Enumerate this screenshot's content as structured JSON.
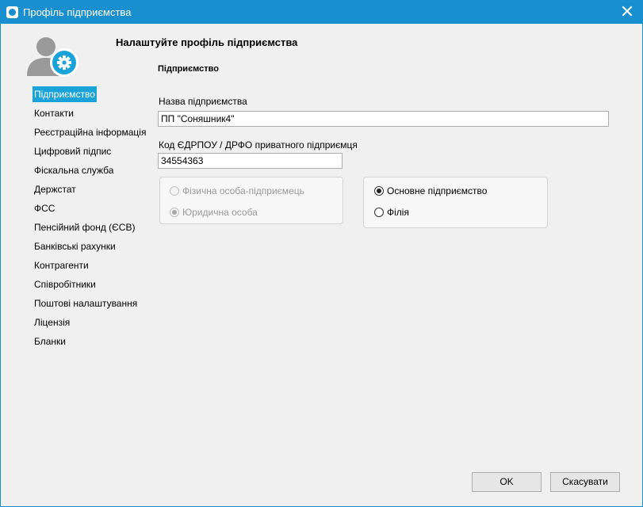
{
  "window": {
    "title": "Профіль підприємства"
  },
  "heading": "Налаштуйте профіль підприємства",
  "nav": {
    "items": [
      {
        "label": "Підприємство",
        "active": true
      },
      {
        "label": "Контакти"
      },
      {
        "label": "Реєстраційна інформація"
      },
      {
        "label": "Цифровий підпис"
      },
      {
        "label": "Фіскальна служба"
      },
      {
        "label": "Держстат"
      },
      {
        "label": "ФСС"
      },
      {
        "label": "Пенсійний фонд (ЄСВ)"
      },
      {
        "label": "Банківські рахунки"
      },
      {
        "label": "Контрагенти"
      },
      {
        "label": "Співробітники"
      },
      {
        "label": "Поштові налаштування"
      },
      {
        "label": "Ліцензія"
      },
      {
        "label": "Бланки"
      }
    ]
  },
  "section": {
    "title": "Підприємство",
    "name_label": "Назва підприємства",
    "name_value": "ПП \"Соняшник4\"",
    "code_label": "Код ЄДРПОУ / ДРФО приватного підприємця",
    "code_value": "34554363"
  },
  "person_type": {
    "disabled": true,
    "options": [
      {
        "label": "Фізична особа-підприємець",
        "checked": false
      },
      {
        "label": "Юридична особа",
        "checked": true
      }
    ]
  },
  "org_type": {
    "options": [
      {
        "label": "Основне підприємство",
        "checked": true
      },
      {
        "label": "Філія",
        "checked": false
      }
    ]
  },
  "buttons": {
    "ok": "OK",
    "cancel": "Скасувати"
  },
  "icons": {
    "app": "app-logo-icon",
    "close": "close-icon",
    "avatar": "user-settings-icon"
  },
  "colors": {
    "titlebar": "#1a8fd0",
    "nav_active": "#1aa3d8",
    "avatar": "#9a9a9a",
    "gear": "#1aa3d8"
  }
}
